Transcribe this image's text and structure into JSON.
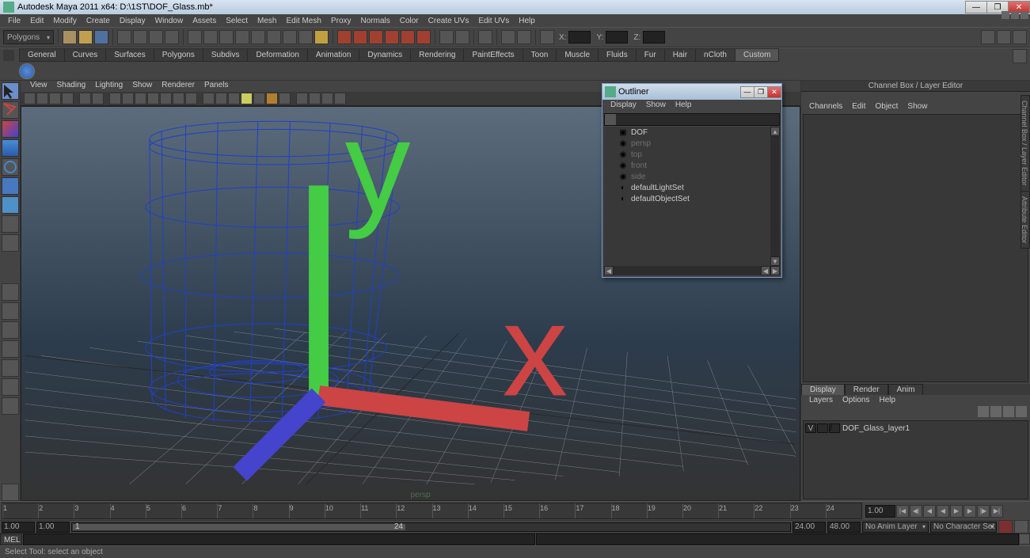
{
  "title": "Autodesk Maya 2011 x64: D:\\1ST\\DOF_Glass.mb*",
  "menubar": [
    "File",
    "Edit",
    "Modify",
    "Create",
    "Display",
    "Window",
    "Assets",
    "Select",
    "Mesh",
    "Edit Mesh",
    "Proxy",
    "Normals",
    "Color",
    "Create UVs",
    "Edit UVs",
    "Help"
  ],
  "mode_dropdown": "Polygons",
  "coords": {
    "x_label": "X:",
    "y_label": "Y:",
    "z_label": "Z:"
  },
  "shelf_tabs": [
    "General",
    "Curves",
    "Surfaces",
    "Polygons",
    "Subdivs",
    "Deformation",
    "Animation",
    "Dynamics",
    "Rendering",
    "PaintEffects",
    "Toon",
    "Muscle",
    "Fluids",
    "Fur",
    "Hair",
    "nCloth",
    "Custom"
  ],
  "shelf_active": "Custom",
  "viewport_menubar": [
    "View",
    "Shading",
    "Lighting",
    "Show",
    "Renderer",
    "Panels"
  ],
  "viewport_label": "persp",
  "outliner": {
    "title": "Outliner",
    "menu": [
      "Display",
      "Show",
      "Help"
    ],
    "items": [
      {
        "label": "DOF",
        "dim": false,
        "icon": "cube"
      },
      {
        "label": "persp",
        "dim": true,
        "icon": "cam"
      },
      {
        "label": "top",
        "dim": true,
        "icon": "cam"
      },
      {
        "label": "front",
        "dim": true,
        "icon": "cam"
      },
      {
        "label": "side",
        "dim": true,
        "icon": "cam"
      },
      {
        "label": "defaultLightSet",
        "dim": false,
        "icon": "set"
      },
      {
        "label": "defaultObjectSet",
        "dim": false,
        "icon": "set"
      }
    ]
  },
  "right_panel": {
    "header": "Channel Box / Layer Editor",
    "tabs": [
      "Channels",
      "Edit",
      "Object",
      "Show"
    ],
    "bottom_tabs": [
      "Display",
      "Render",
      "Anim"
    ],
    "bottom_active": "Display",
    "bottom_menu": [
      "Layers",
      "Options",
      "Help"
    ],
    "layer": {
      "vis": "V",
      "name": "DOF_Glass_layer1"
    }
  },
  "side_tabs": [
    "Channel Box / Layer Editor",
    "Attribute Editor"
  ],
  "timeline": {
    "ticks": [
      "1",
      "2",
      "3",
      "4",
      "5",
      "6",
      "7",
      "8",
      "9",
      "10",
      "11",
      "12",
      "13",
      "14",
      "15",
      "16",
      "17",
      "18",
      "19",
      "20",
      "21",
      "22",
      "23",
      "24"
    ],
    "current_display": "1.00"
  },
  "range": {
    "start": "1.00",
    "in": "1.00",
    "range_start": "1",
    "range_end": "24",
    "out": "24.00",
    "end": "48.00",
    "anim_dropdown": "No Anim Layer",
    "char_dropdown": "No Character Set"
  },
  "mel": {
    "label": "MEL"
  },
  "status": "Select Tool: select an object"
}
